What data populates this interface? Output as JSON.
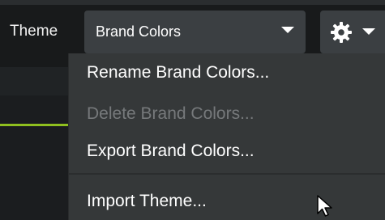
{
  "header": {
    "theme_label": "Theme",
    "theme_select_value": "Brand Colors"
  },
  "icons": {
    "settings": "gear-icon",
    "dropdown": "chevron-down-icon",
    "cursor": "mouse-pointer-icon"
  },
  "menu": {
    "items": [
      {
        "label": "Rename Brand Colors...",
        "enabled": true
      },
      {
        "label": "Delete Brand Colors...",
        "enabled": false
      },
      {
        "label": "Export Brand Colors...",
        "enabled": true
      },
      {
        "label": "Import Theme...",
        "enabled": true
      }
    ]
  },
  "colors": {
    "accent_line": "#8fbf1f",
    "menu_background": "#353839",
    "control_background": "#3b3f42"
  }
}
